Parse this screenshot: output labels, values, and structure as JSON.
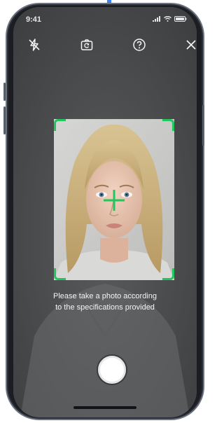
{
  "status_bar": {
    "time": "9:41",
    "icons": [
      "signal-icon",
      "wifi-icon",
      "battery-icon"
    ]
  },
  "toolbar": {
    "buttons": [
      {
        "icon": "flash-off-icon"
      },
      {
        "icon": "camera-switch-icon"
      },
      {
        "icon": "help-icon"
      },
      {
        "icon": "close-icon"
      }
    ]
  },
  "instruction": {
    "line1": "Please take a photo according",
    "line2": "to the specifications provided"
  },
  "colors": {
    "frame_guides": "#22c55e",
    "screen_background": "#4a4b4d",
    "accent": "#3b82f6"
  }
}
